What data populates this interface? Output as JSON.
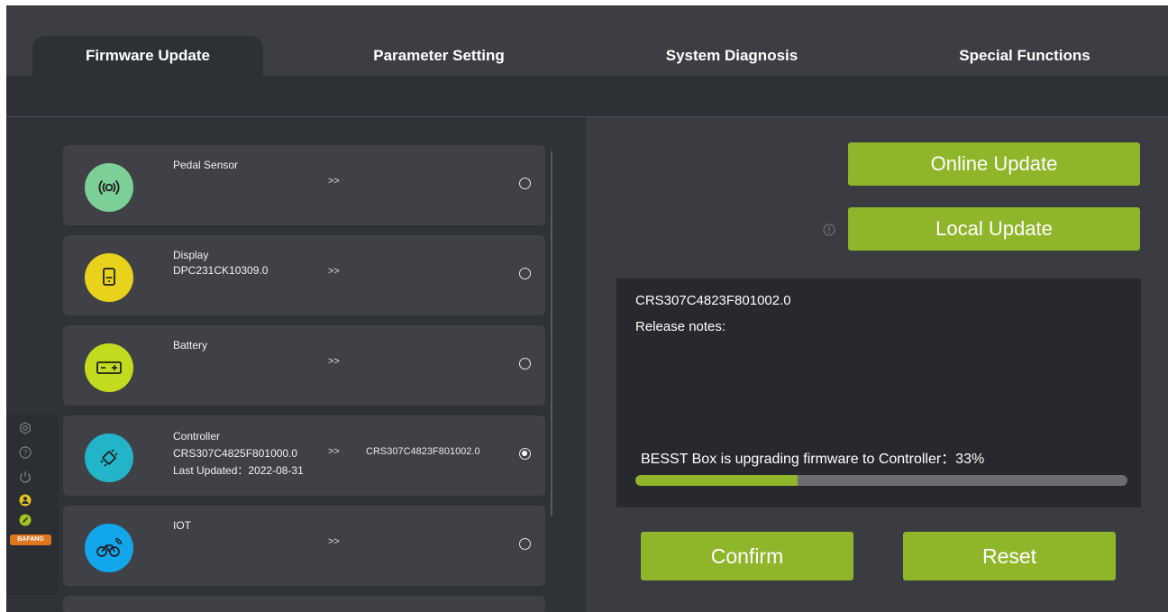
{
  "tabs": [
    {
      "label": "Firmware Update",
      "active": true
    },
    {
      "label": "Parameter Setting",
      "active": false
    },
    {
      "label": "System Diagnosis",
      "active": false
    },
    {
      "label": "Special Functions",
      "active": false
    }
  ],
  "devices": [
    {
      "name": "Pedal Sensor",
      "version": "",
      "updated": "",
      "arrow": ">>",
      "target": "",
      "selected": false,
      "icon": "pedal-sensor-icon",
      "color": "#7ccf96"
    },
    {
      "name": "Display",
      "version": "DPC231CK10309.0",
      "updated": "",
      "arrow": ">>",
      "target": "",
      "selected": false,
      "icon": "display-icon",
      "color": "#e9d21b"
    },
    {
      "name": "Battery",
      "version": "",
      "updated": "",
      "arrow": ">>",
      "target": "",
      "selected": false,
      "icon": "battery-icon",
      "color": "#c3db1e"
    },
    {
      "name": "Controller",
      "version": "CRS307C4825F801000.0",
      "updated": "Last Updated：2022-08-31",
      "arrow": ">>",
      "target": "CRS307C4823F801002.0",
      "selected": true,
      "icon": "controller-icon",
      "color": "#22b5c9"
    },
    {
      "name": "IOT",
      "version": "",
      "updated": "",
      "arrow": ">>",
      "target": "",
      "selected": false,
      "icon": "iot-bike-icon",
      "color": "#12a6ea"
    }
  ],
  "actions": {
    "online_update": "Online Update",
    "local_update": "Local Update",
    "confirm": "Confirm",
    "reset": "Reset"
  },
  "notes": {
    "version": "CRS307C4823F801002.0",
    "release_label": "Release notes:",
    "progress_text": "BESST Box is upgrading firmware to Controller：33%",
    "progress": 0.33
  },
  "sidebar": {
    "icons": [
      "settings-icon",
      "help-icon",
      "power-icon",
      "user-icon",
      "link-icon"
    ],
    "logo_text": "BAFANG"
  },
  "colors": {
    "accent": "#8fb52a",
    "background": "#3c3e43",
    "panel": "#2f3237"
  }
}
